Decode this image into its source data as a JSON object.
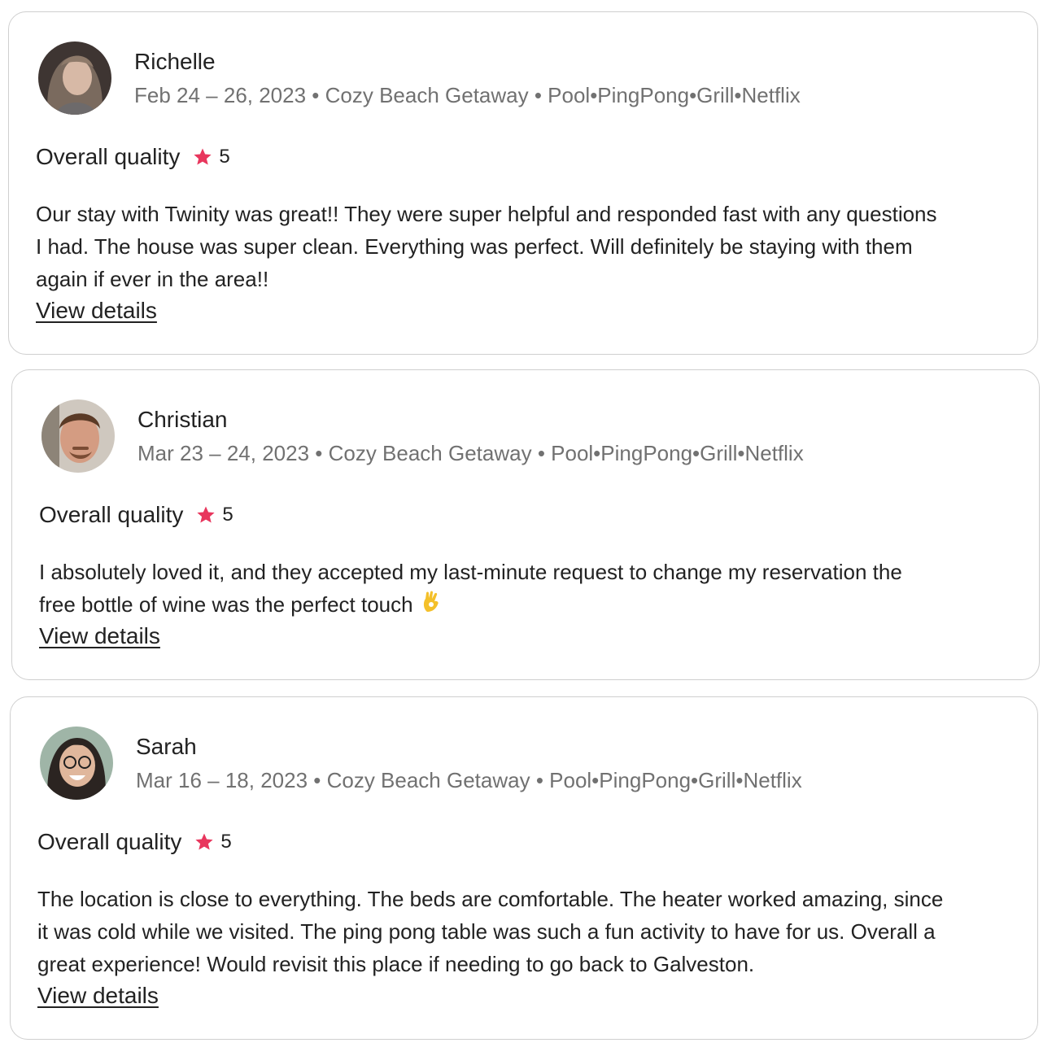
{
  "colors": {
    "star": "#e8365d",
    "text_primary": "#222222",
    "text_secondary": "#717171",
    "border": "#cfcfcf"
  },
  "reviews": [
    {
      "name": "Richelle",
      "meta": "Feb 24 – 26, 2023 • Cozy Beach Getaway • Pool•PingPong•Grill•Netflix",
      "rating_label": "Overall quality",
      "rating_value": "5",
      "text_lines": [
        "Our stay with Twinity was great!! They were super helpful and responded fast with any questions",
        "I had. The house was super clean. Everything was perfect. Will definitely be staying with them",
        "again if ever in the area!!"
      ],
      "link_label": "View details",
      "avatar_icon": "avatar-photo-icon"
    },
    {
      "name": "Christian",
      "meta": "Mar 23 – 24, 2023 • Cozy Beach Getaway • Pool•PingPong•Grill•Netflix",
      "rating_label": "Overall quality",
      "rating_value": "5",
      "text_lines": [
        "I absolutely loved it, and they accepted my last-minute request to change my reservation the",
        "free bottle of wine was the perfect touch"
      ],
      "emoji": "ok-hand-emoji",
      "link_label": "View details",
      "avatar_icon": "avatar-photo-icon"
    },
    {
      "name": "Sarah",
      "meta": "Mar 16 – 18, 2023 • Cozy Beach Getaway • Pool•PingPong•Grill•Netflix",
      "rating_label": "Overall quality",
      "rating_value": "5",
      "text_lines": [
        "The location is close to everything. The beds are comfortable. The heater worked amazing, since",
        "it was cold while we visited. The ping pong table was such a fun activity to have for us. Overall a",
        "great experience! Would revisit this place if needing to go back to Galveston."
      ],
      "link_label": "View details",
      "avatar_icon": "avatar-photo-icon"
    }
  ]
}
